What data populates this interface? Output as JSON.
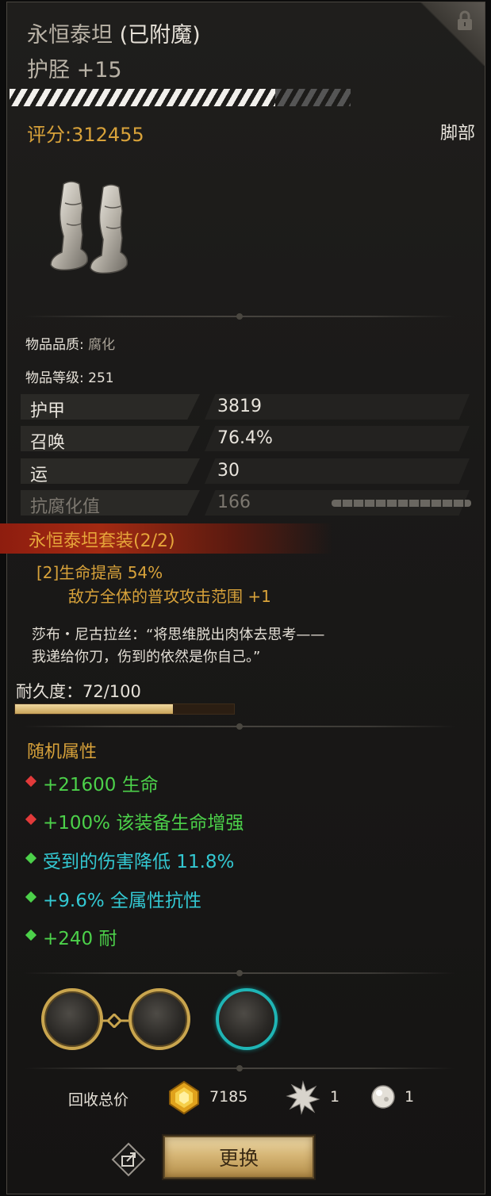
{
  "item": {
    "name": "永恒泰坦",
    "enchant_tag": "(已附魔)",
    "type_line": "护胫 +15",
    "score": "评分:312455",
    "slot": "脚部",
    "image_icon": "armored-greaves-icon",
    "upgrade_progress": 0.78
  },
  "info": {
    "quality_label": "物品品质:",
    "quality_value": "腐化",
    "level_label": "物品等级:",
    "level_value": "251"
  },
  "stats": [
    {
      "label": "护甲",
      "value": "3819"
    },
    {
      "label": "召唤",
      "value": "76.4%"
    },
    {
      "label": "运",
      "value": "30"
    },
    {
      "label": "抗腐化值",
      "value": "166"
    }
  ],
  "set_bonus": {
    "title": "永恒泰坦套装(2/2)",
    "tier": "[2]",
    "line1": "生命提高 54%",
    "line2": "敌方全体的普攻攻击范围 +1"
  },
  "flavor": {
    "line1": "莎布・尼古拉丝：“将思维脱出肉体去思考——",
    "line2": "我递给你刀，伤到的依然是你自己。”"
  },
  "durability": {
    "text": "耐久度：72/100",
    "current": 72,
    "max": 100
  },
  "random_attrs": {
    "title": "随机属性",
    "items": [
      {
        "text": "+21600 生命",
        "gem": "red"
      },
      {
        "text": "+100% 该装备生命增强",
        "gem": "red"
      },
      {
        "text": "受到的伤害降低 11.8%",
        "gem": "green"
      },
      {
        "text": "+9.6% 全属性抗性",
        "gem": "green"
      },
      {
        "text": "+240 耐",
        "gem": "green"
      }
    ]
  },
  "sockets": [
    {
      "type": "gold",
      "linked": true
    },
    {
      "type": "gold",
      "linked": true
    },
    {
      "type": "teal",
      "linked": false
    }
  ],
  "recycle": {
    "label": "回收总价",
    "costs": [
      {
        "icon": "gold-crystal-icon",
        "amount": "7185"
      },
      {
        "icon": "spiky-shard-icon",
        "amount": "1"
      },
      {
        "icon": "white-pearl-icon",
        "amount": "1"
      }
    ]
  },
  "actions": {
    "replace_label": "更换",
    "share_icon": "share-icon"
  },
  "colors": {
    "gold": "#d8a23a",
    "green": "#4cd14a",
    "cyan": "#33c8d2",
    "red_gem": "#e23a3a",
    "set_banner": "#a32a12"
  }
}
